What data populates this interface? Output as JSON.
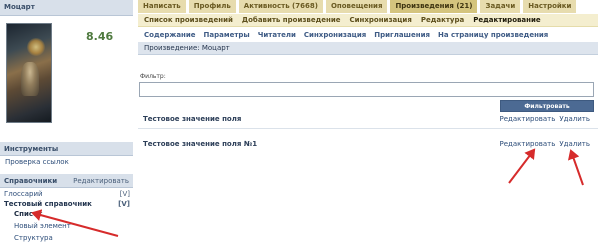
{
  "sidebar": {
    "user_header": "Моцарт",
    "rating": "8.46",
    "tools_header": "Инструменты",
    "tools_items": [
      "Проверка ссылок"
    ],
    "dict_header": "Справочники",
    "dict_edit": "Редактировать",
    "dict_items": [
      {
        "label": "Глоссарий",
        "flag": "[V]"
      },
      {
        "label": "Тестовый справочник",
        "flag": "[V]"
      }
    ],
    "dict_subitems": [
      "Список",
      "Новый элемент",
      "Структура"
    ]
  },
  "tabs": [
    {
      "label": "Написать"
    },
    {
      "label": "Профиль"
    },
    {
      "label": "Активность (7668)"
    },
    {
      "label": "Оповещения"
    },
    {
      "label": "Произведения (21)"
    },
    {
      "label": "Задачи"
    },
    {
      "label": "Настройки"
    }
  ],
  "subnav": [
    "Список произведений",
    "Добавить произведение",
    "Синхронизация",
    "Редактура",
    "Редактирование"
  ],
  "subnav2": [
    "Содержание",
    "Параметры",
    "Читатели",
    "Синхронизация",
    "Приглашения",
    "На страницу произведения"
  ],
  "work_header": "Произведение: Моцарт",
  "filter": {
    "label": "Фильтр:",
    "value": "",
    "button": "Фильтровать"
  },
  "entries": [
    {
      "title": "Тестовое значение поля",
      "edit": "Редактировать",
      "delete": "Удалить"
    },
    {
      "title": "Тестовое значение поля №1",
      "edit": "Редактировать",
      "delete": "Удалить"
    }
  ],
  "colors": {
    "arrow": "#d62b2b",
    "tab": "#e7dcae",
    "tab_active": "#d4c47e",
    "filter_button": "#4c6a93"
  }
}
